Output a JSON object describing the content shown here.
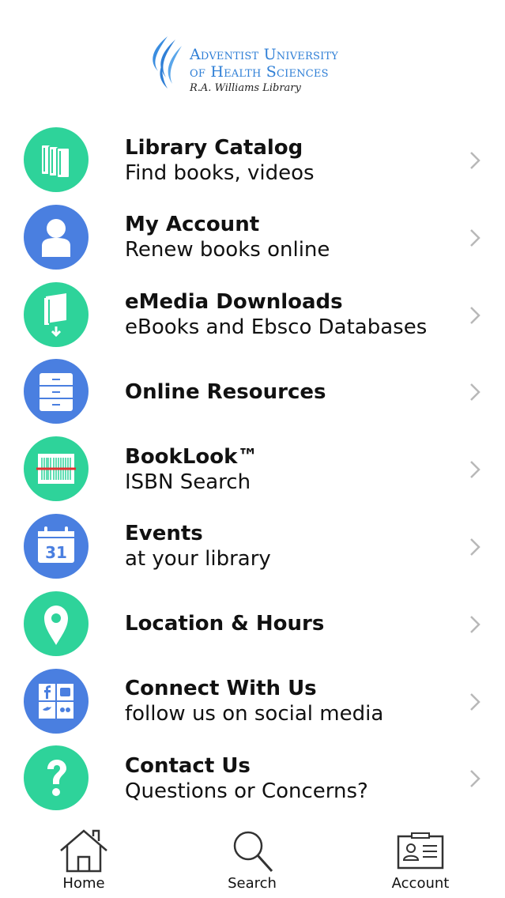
{
  "header": {
    "logo_line1": "Adventist University",
    "logo_line2": "of Health Sciences",
    "logo_line3": "R.A. Williams Library"
  },
  "menu": [
    {
      "title": "Library Catalog",
      "subtitle": "Find books, videos",
      "icon": "books-icon",
      "color": "#2ed39a"
    },
    {
      "title": "My Account",
      "subtitle": "Renew books online",
      "icon": "person-icon",
      "color": "#4a7fe0"
    },
    {
      "title": "eMedia Downloads",
      "subtitle": "eBooks and Ebsco Databases",
      "icon": "ebook-download-icon",
      "color": "#2ed39a"
    },
    {
      "title": "Online Resources",
      "subtitle": "",
      "icon": "filing-cabinet-icon",
      "color": "#4a7fe0"
    },
    {
      "title": "BookLook™",
      "subtitle": "ISBN Search",
      "icon": "barcode-icon",
      "color": "#2ed39a"
    },
    {
      "title": "Events",
      "subtitle": "at your library",
      "icon": "calendar-icon",
      "color": "#4a7fe0",
      "calendar_day": "31"
    },
    {
      "title": "Location & Hours",
      "subtitle": "",
      "icon": "map-pin-icon",
      "color": "#2ed39a"
    },
    {
      "title": "Connect With Us",
      "subtitle": "follow us on social media",
      "icon": "social-media-icon",
      "color": "#4a7fe0"
    },
    {
      "title": "Contact Us",
      "subtitle": "Questions or Concerns?",
      "icon": "question-mark-icon",
      "color": "#2ed39a"
    }
  ],
  "tabbar": {
    "home": "Home",
    "search": "Search",
    "account": "Account"
  }
}
